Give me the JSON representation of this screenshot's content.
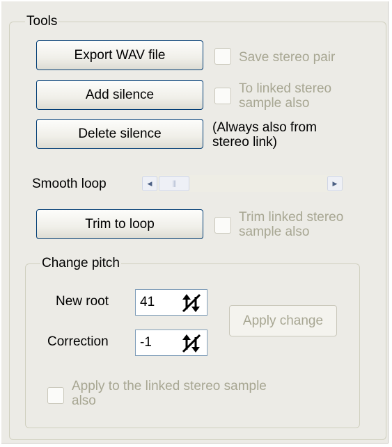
{
  "tools": {
    "title": "Tools",
    "export_button": "Export WAV file",
    "save_stereo_pair": {
      "label": "Save  stereo pair",
      "checked": false,
      "enabled": false
    },
    "add_silence_button": "Add silence",
    "to_linked_stereo": {
      "label_line1": "To linked stereo",
      "label_line2": "sample also",
      "checked": false,
      "enabled": false
    },
    "delete_silence_button": "Delete silence",
    "always_note_line1": "(Always also from",
    "always_note_line2": "stereo link)",
    "smooth_loop_label": "Smooth loop",
    "trim_button": "Trim to loop",
    "trim_linked": {
      "label_line1": "Trim linked stereo",
      "label_line2": "sample also",
      "checked": false,
      "enabled": false
    }
  },
  "change_pitch": {
    "title": "Change pitch",
    "new_root_label": "New root",
    "new_root_value": "41",
    "correction_label": "Correction",
    "correction_value": "-1",
    "apply_change_button": "Apply change",
    "apply_linked": {
      "label_line1": "Apply to the linked stereo sample",
      "label_line2": "also",
      "checked": false,
      "enabled": false
    }
  },
  "icons": {
    "scroll_left": "triangle-left",
    "scroll_right": "triangle-right",
    "spin": "spin-arrows-icon"
  }
}
